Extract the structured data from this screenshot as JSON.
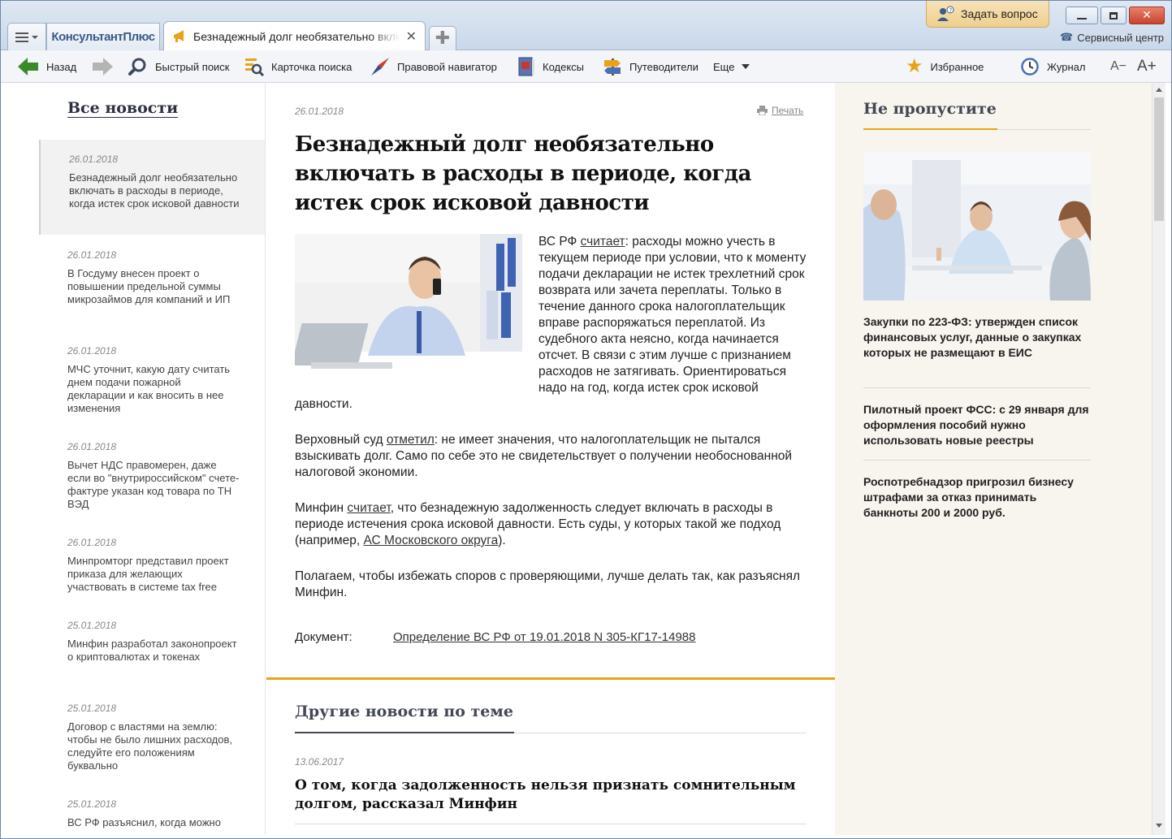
{
  "window": {
    "brand": "КонсультантПлюс",
    "tab_title": "Безнадежный долг необязательно включ",
    "ask_button": "Задать вопрос",
    "service_center": "Сервисный центр"
  },
  "toolbar": {
    "back": "Назад",
    "quick_search": "Быстрый поиск",
    "search_card": "Карточка поиска",
    "legal_navigator": "Правовой навигатор",
    "codes": "Кодексы",
    "guides": "Путеводители",
    "more": "Еще",
    "favorites": "Избранное",
    "journal": "Журнал",
    "font_smaller": "A−",
    "font_larger": "A+"
  },
  "sidebar": {
    "title": "Все новости",
    "items": [
      {
        "date": "26.01.2018",
        "text": "Безнадежный долг необязательно включать в расходы в периоде, когда истек срок исковой давности"
      },
      {
        "date": "26.01.2018",
        "text": "В Госдуму внесен проект о повышении предельной суммы микрозаймов для компаний и ИП"
      },
      {
        "date": "26.01.2018",
        "text": "МЧС уточнит, какую дату считать днем подачи пожарной декларации и как вносить в нее изменения"
      },
      {
        "date": "26.01.2018",
        "text": "Вычет НДС правомерен, даже если во \"внутрироссийском\" счете-фактуре указан код товара по ТН ВЭД"
      },
      {
        "date": "26.01.2018",
        "text": "Минпромторг представил проект приказа для желающих участвовать в системе tax free"
      },
      {
        "date": "25.01.2018",
        "text": "Минфин разработал законопроект о криптовалютах и токенах"
      },
      {
        "date": "25.01.2018",
        "text": "Договор с властями на землю: чтобы не было лишних расходов, следуйте его положениям буквально"
      },
      {
        "date": "25.01.2018",
        "text": "ВС РФ разъяснил, когда можно"
      }
    ]
  },
  "article": {
    "date": "26.01.2018",
    "print": "Печать",
    "title": "Безнадежный долг необязательно включать в расходы в периоде, когда истек срок исковой давности",
    "p1_pre": "ВС РФ ",
    "p1_link": "считает",
    "p1_post": ": расходы можно учесть в текущем периоде при условии, что к моменту подачи декларации не истек трехлетний срок возврата или зачета переплаты. Только в течение данного срока налогоплательщик вправе распоряжаться переплатой. Из судебного акта неясно, когда начинается отсчет. В связи с этим лучше с признанием расходов не затягивать. Ориентироваться надо на год, когда истек срок исковой давности.",
    "p2_pre": "Верховный суд ",
    "p2_link": "отметил",
    "p2_post": ": не имеет значения, что налогоплательщик не пытался взыскивать долг. Само по себе это не свидетельствует о получении необоснованной налоговой экономии.",
    "p3_pre": "Минфин ",
    "p3_link": "считает",
    "p3_mid": ", что безнадежную задолженность следует включать в расходы в периоде истечения срока исковой давности. Есть суды, у которых такой же подход (например, ",
    "p3_link2": "АС Московского округа",
    "p3_post": ").",
    "p4": "Полагаем, чтобы избежать споров с проверяющими, лучше делать так, как разъяснял Минфин.",
    "doc_label": "Документ:",
    "doc_link": "Определение ВС РФ от 19.01.2018 N 305-КГ17-14988"
  },
  "other": {
    "title": "Другие новости по теме",
    "date": "13.06.2017",
    "news": "О том, когда задолженность нельзя признать сомнительным долгом, рассказал Минфин"
  },
  "right_panel": {
    "title": "Не пропустите",
    "items": [
      "Закупки по 223-ФЗ: утвержден список финансовых услуг, данные о закупках которых не размещают в ЕИС",
      "Пилотный проект ФСС: с 29 января для оформления пособий нужно использовать новые реестры",
      "Роспотребнадзор пригрозил бизнесу штрафами за отказ принимать банкноты 200 и 2000 руб."
    ]
  },
  "colors": {
    "accent_orange": "#e8a317",
    "heading_dark": "#444855",
    "right_bg": "#f8f4ee"
  }
}
